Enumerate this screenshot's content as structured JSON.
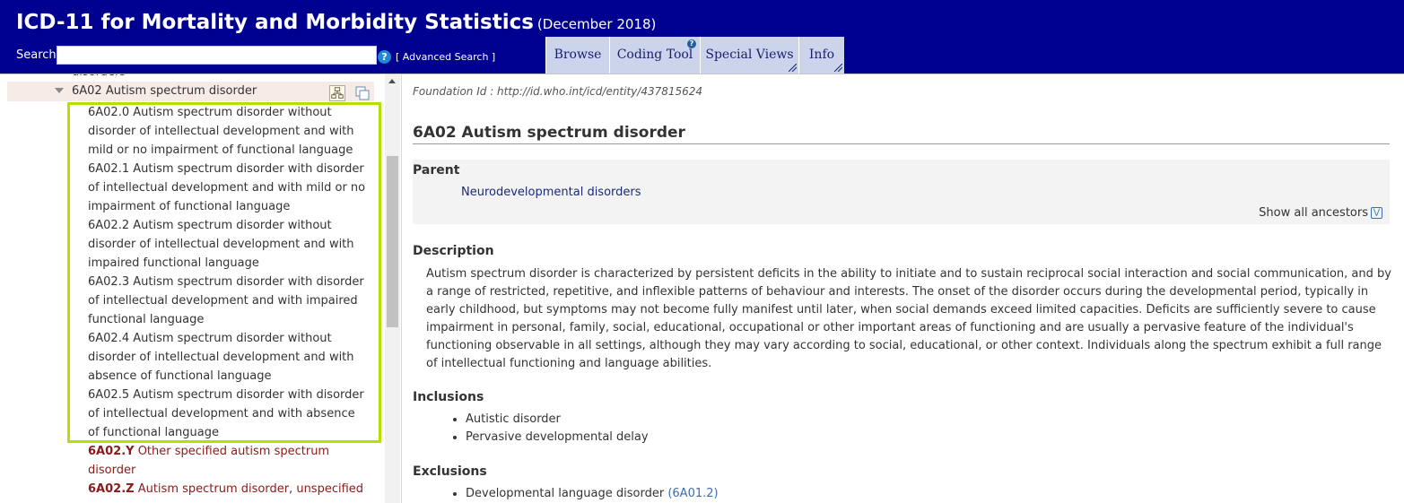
{
  "header": {
    "title": "ICD-11 for Mortality and Morbidity Statistics",
    "edition": "(December 2018)",
    "search_label": "Search",
    "search_value": "",
    "advanced_search": "[ Advanced Search ]",
    "help_glyph": "?",
    "tabs": [
      {
        "label": "Browse"
      },
      {
        "label": "Coding Tool"
      },
      {
        "label": "Special Views"
      },
      {
        "label": "Info"
      }
    ],
    "colors": {
      "bar": "#000090",
      "tab_bg": "#ccd4ec"
    }
  },
  "tree": {
    "top_cut_label": "disorders",
    "selected": "6A02 Autism spectrum disorder",
    "children": [
      {
        "code": "6A02.0",
        "lines": [
          "6A02.0 Autism spectrum disorder without",
          "disorder of intellectual development and with",
          "mild or no impairment of functional language"
        ]
      },
      {
        "code": "6A02.1",
        "lines": [
          "6A02.1 Autism spectrum disorder with disorder",
          "of intellectual development and with mild or no",
          "impairment of functional language"
        ]
      },
      {
        "code": "6A02.2",
        "lines": [
          "6A02.2 Autism spectrum disorder without",
          "disorder of intellectual development and with",
          "impaired functional language"
        ]
      },
      {
        "code": "6A02.3",
        "lines": [
          "6A02.3 Autism spectrum disorder with disorder",
          "of intellectual development and with impaired",
          "functional language"
        ]
      },
      {
        "code": "6A02.4",
        "lines": [
          "6A02.4 Autism spectrum disorder without",
          "disorder of intellectual development and with",
          "absence of functional language"
        ]
      },
      {
        "code": "6A02.5",
        "lines": [
          "6A02.5 Autism spectrum disorder with disorder",
          "of intellectual development and with absence",
          "of functional language"
        ]
      }
    ],
    "residuals": [
      {
        "code": "6A02.Y",
        "rest1": "Other specified autism spectrum",
        "rest2": "disorder"
      },
      {
        "code": "6A02.Z",
        "rest1": "Autism spectrum disorder, unspecified"
      }
    ],
    "highlight_color": "#b4e000"
  },
  "entity": {
    "foundation_id": "Foundation Id : http://id.who.int/icd/entity/437815624",
    "title": "6A02 Autism spectrum disorder",
    "parent_label": "Parent",
    "parent_link": "Neurodevelopmental disorders",
    "show_ancestors": "Show all ancestors",
    "description_label": "Description",
    "description": "Autism spectrum disorder is characterized by persistent deficits in the ability to initiate and to sustain reciprocal social interaction and social communication, and by a range of restricted, repetitive, and inflexible patterns of behaviour and interests. The onset of the disorder occurs during the developmental period, typically in early childhood, but symptoms may not become fully manifest until later, when social demands exceed limited capacities. Deficits are sufficiently severe to cause impairment in personal, family, social, educational, occupational or other important areas of functioning and are usually a pervasive feature of the individual's functioning observable in all settings, although they may vary according to social, educational, or other context. Individuals along the spectrum exhibit a full range of intellectual functioning and language abilities.",
    "inclusions_label": "Inclusions",
    "inclusions": [
      "Autistic disorder",
      "Pervasive developmental delay"
    ],
    "exclusions_label": "Exclusions",
    "exclusions": [
      {
        "text": "Developmental language disorder",
        "code": "(6A01.2)"
      }
    ]
  }
}
